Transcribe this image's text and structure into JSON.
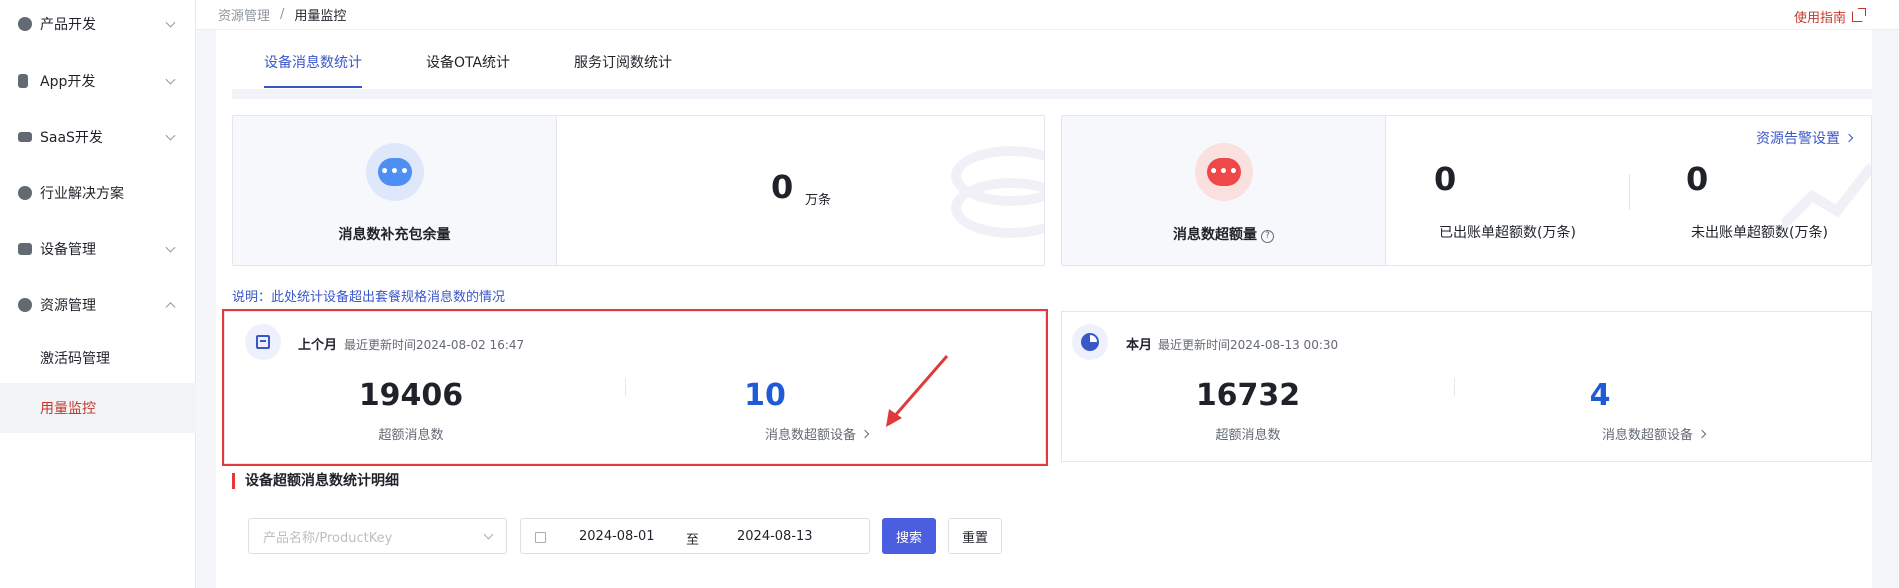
{
  "sidebar": {
    "items": [
      {
        "label": "产品开发",
        "icon": "product-icon"
      },
      {
        "label": "App开发",
        "icon": "phone-icon"
      },
      {
        "label": "SaaS开发",
        "icon": "monitor-icon"
      },
      {
        "label": "行业解决方案",
        "icon": "solution-icon"
      },
      {
        "label": "设备管理",
        "icon": "server-icon"
      },
      {
        "label": "资源管理",
        "icon": "resource-icon"
      }
    ],
    "subitems": [
      {
        "label": "激活码管理"
      },
      {
        "label": "用量监控"
      }
    ]
  },
  "breadcrumb": {
    "parent": "资源管理",
    "separator": "/",
    "current": "用量监控"
  },
  "guide_link": "使用指南",
  "tabs": [
    {
      "label": "设备消息数统计"
    },
    {
      "label": "设备OTA统计"
    },
    {
      "label": "服务订阅数统计"
    }
  ],
  "package_card": {
    "icon_text": "•••",
    "label": "消息数补充包余量",
    "value": "0",
    "unit": "万条"
  },
  "overage_card": {
    "icon_text": "•••",
    "label": "消息数超额量",
    "help": "?",
    "alert_link": "资源告警设置",
    "billed": {
      "value": "0",
      "label": "已出账单超额数(万条)"
    },
    "unbilled": {
      "value": "0",
      "label": "未出账单超额数(万条)"
    }
  },
  "note": "说明：此处统计设备超出套餐规格消息数的情况",
  "last_month": {
    "title": "上个月",
    "updated": "最近更新时间2024-08-02 16:47",
    "excess_value": "19406",
    "excess_label": "超额消息数",
    "devices_value": "10",
    "devices_label": "消息数超额设备"
  },
  "this_month": {
    "title": "本月",
    "updated": "最近更新时间2024-08-13 00:30",
    "excess_value": "16732",
    "excess_label": "超额消息数",
    "devices_value": "4",
    "devices_label": "消息数超额设备"
  },
  "detail": {
    "title": "设备超额消息数统计明细",
    "product_placeholder": "产品名称/ProductKey",
    "date_start": "2024-08-01",
    "date_sep": "至",
    "date_end": "2024-08-13",
    "search": "搜索",
    "reset": "重置"
  },
  "colors": {
    "accent": "#3a57c9",
    "active_menu": "#c0392b",
    "highlight": "#e03a3a",
    "primary_button": "#4b5ee0"
  }
}
